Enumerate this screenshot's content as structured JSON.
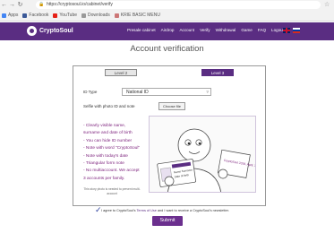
{
  "browser": {
    "url": "https://cryptosoul.io/cabinet/verify",
    "bookmarks": [
      "Apps",
      "Facebook",
      "YouTube",
      "Downloads",
      "KRIE BASIC MENU"
    ]
  },
  "site": {
    "logo_text": "CryptoSoul",
    "nav": [
      "Presale cabinet",
      "Airdrop",
      "Account",
      "Verify",
      "Withdrawal",
      "Game",
      "FAQ",
      "Logout"
    ]
  },
  "page": {
    "title": "Account verification",
    "tabs": [
      "Level 2",
      "Level 3"
    ],
    "id_type_label": "ID Type",
    "id_type_value": "National ID",
    "selfie_label": "Selfie with photo ID and note",
    "choose_file": "Choose file",
    "instructions": [
      "- Clearly visible name, surname and date of birth",
      "- You can hide ID number",
      "- Note with word \"CryptoSoul\"",
      "- Note with today's date",
      "- Triangular form note",
      "- No multiaccount. We accept 3 accounts per family."
    ],
    "privacy_note": "This story photo is needed to prevent multi-account",
    "illustration": {
      "note_text": "CryptoSoul 2018, April, 30",
      "card_name": "Name Surname",
      "card_id": "Date of birth"
    },
    "tos_prefix": "I agree to CryptoSoul's",
    "tos_link": "Terms of Use",
    "tos_suffix": "and I want to receive a CryptoSoul's newsletter.",
    "submit": "Submit"
  }
}
